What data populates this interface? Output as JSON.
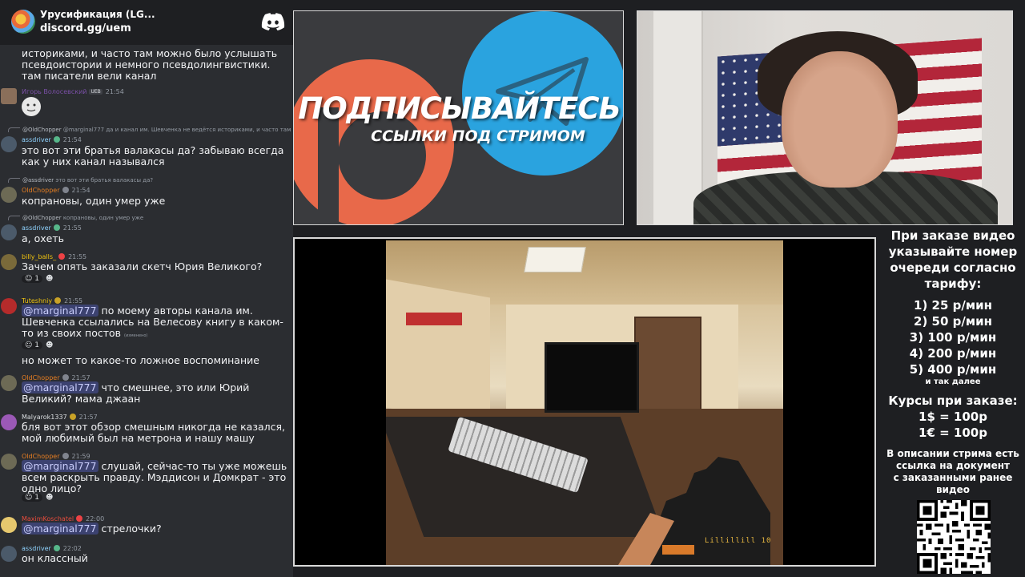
{
  "chat": {
    "server_name": "Урусификация (LG...",
    "server_link": "discord.gg/uem",
    "messages": [
      {
        "text": "историками, и часто там можно было услышать псевдоистории и немного псевдолингвистики. там писатели вели канал"
      },
      {
        "username": "Игорь Волосевский",
        "tag": "UEB",
        "time": "21:54",
        "sticker": "face-sticker"
      },
      {
        "reply_user": "@OldChopper",
        "reply_text": "@marginal777 да и канал им. Шевченка не ведётся историками, и часто там можно",
        "username": "assdriver",
        "time": "21:54",
        "text": "это вот эти братья валакасы да? забываю всегда как у них канал назывался"
      },
      {
        "reply_user": "@assdriver",
        "reply_text": "это вот эти братья валакасы да?",
        "username": "OldChopper",
        "time": "21:54",
        "text": "копрановы, один умер уже"
      },
      {
        "reply_user": "@OldChopper",
        "reply_text": "копрановы, один умер уже",
        "username": "assdriver",
        "time": "21:55",
        "text": "а, охеть"
      },
      {
        "username": "billy_balls_",
        "time": "21:55",
        "text": "Зачем опять заказали скетч Юрия Великого?",
        "reaction_count": "1"
      },
      {
        "username": "Tuteshniy",
        "time": "21:55",
        "mention": "@marginal777",
        "text": " по моему авторы канала им. Шевченка ссылались на Велесову книгу в каком-то из своих постов",
        "edited": "(изменено)",
        "reaction_count": "1",
        "text2": "но может то какое-то ложное воспоминание"
      },
      {
        "username": "OldChopper",
        "time": "21:57",
        "mention": "@marginal777",
        "text": " что смешнее, это или Юрий Великий? мама джаан"
      },
      {
        "username": "Malyarok1337",
        "time": "21:57",
        "text": "бля вот этот обзор смешным никогда не казался, мой любимый был на метрона и нашу машу"
      },
      {
        "username": "OldChopper",
        "time": "21:59",
        "mention": "@marginal777",
        "text": " слушай, сейчас-то ты уже можешь всем раскрыть правду. Мэддисон и Домкрат - это одно лицо?",
        "reaction_count": "1"
      },
      {
        "username": "MaximKoschatel",
        "time": "22:00",
        "mention": "@marginal777",
        "text": " стрелочки?"
      },
      {
        "username": "assdriver",
        "time": "22:02",
        "text": "он классный"
      }
    ]
  },
  "promo": {
    "title": "ПОДПИСЫВАЙТЕСЬ",
    "subtitle": "ССЫЛКИ ПОД СТРИМОМ"
  },
  "video": {
    "hud": "Lillillill 10"
  },
  "info": {
    "intro": [
      "При заказе видео",
      "указывайте номер",
      "очереди согласно",
      "тарифу:"
    ],
    "tariffs": [
      "1) 25 р/мин",
      "2) 50 р/мин",
      "3) 100 р/мин",
      "4) 200 р/мин",
      "5) 400 р/мин"
    ],
    "tariffs_more": "и так далее",
    "rates_title": "Курсы при заказе:",
    "rates": [
      "1$ = 100р",
      "1€ = 100р"
    ],
    "desc": [
      "В описании стрима есть",
      "ссылка на документ",
      "с заказанными ранее",
      "видео"
    ]
  },
  "colors": {
    "chat_bg": "#2b2d31",
    "mention_bg": "#3c4270",
    "patreon": "#e8694a",
    "telegram": "#2aa3df"
  }
}
